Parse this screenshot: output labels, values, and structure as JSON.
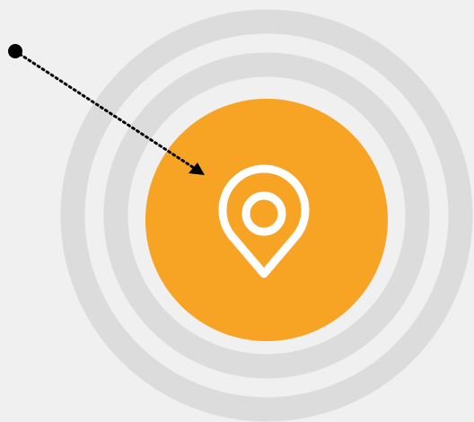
{
  "colors": {
    "background": "#f0f0f0",
    "rings": "#dcdcdc",
    "target": "#f7a324",
    "icon": "#ffffff",
    "pointer": "#000000"
  },
  "icons": {
    "target_icon": "map-pin-icon",
    "path_start": "dot-marker-icon",
    "path_arrow": "arrowhead-icon"
  }
}
